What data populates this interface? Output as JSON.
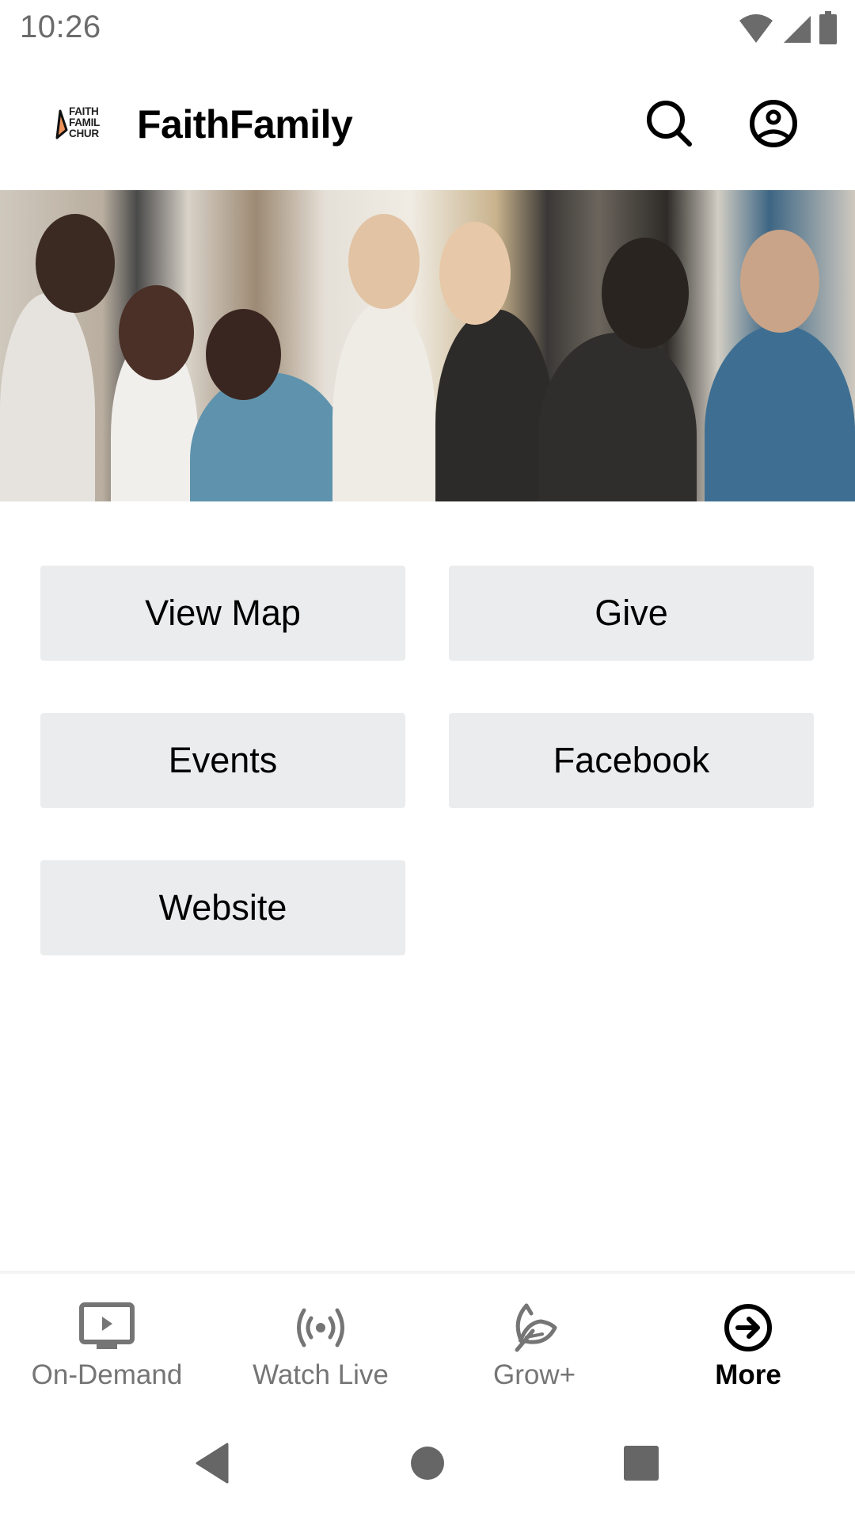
{
  "status_bar": {
    "time": "10:26",
    "icons": [
      "wifi-icon",
      "cellular-signal-icon",
      "battery-icon"
    ]
  },
  "app_bar": {
    "logo_lines": [
      "FAITH",
      "FAMIL",
      "CHUR"
    ],
    "title": "FaithFamily",
    "actions": [
      {
        "name": "search",
        "icon": "search-icon"
      },
      {
        "name": "account",
        "icon": "account-circle-icon"
      }
    ]
  },
  "hero": {
    "description": "Group photo of smiling church members"
  },
  "actions": {
    "buttons": [
      {
        "label": "View Map"
      },
      {
        "label": "Give"
      },
      {
        "label": "Events"
      },
      {
        "label": "Facebook"
      },
      {
        "label": "Website"
      }
    ],
    "button_color": "#ebeced"
  },
  "bottom_nav": {
    "items": [
      {
        "label": "On-Demand",
        "icon": "tv-play-icon",
        "active": false
      },
      {
        "label": "Watch Live",
        "icon": "broadcast-icon",
        "active": false
      },
      {
        "label": "Grow+",
        "icon": "leaf-icon",
        "active": false
      },
      {
        "label": "More",
        "icon": "arrow-circle-right-icon",
        "active": true
      }
    ],
    "inactive_color": "#757575",
    "active_color": "#000000"
  },
  "system_nav": {
    "buttons": [
      "back",
      "home",
      "recents"
    ]
  }
}
